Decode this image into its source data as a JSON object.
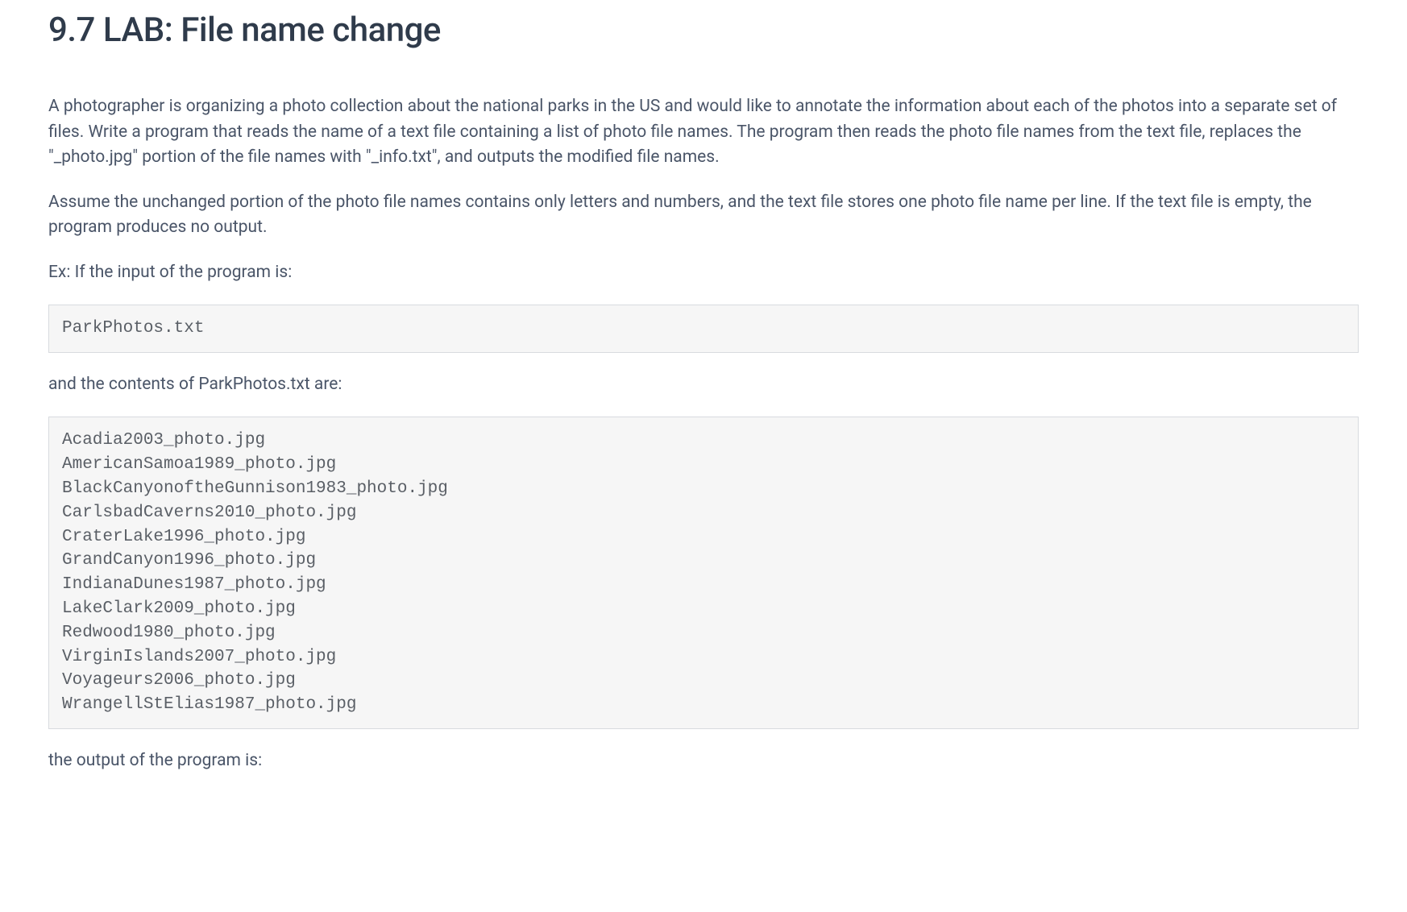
{
  "heading": "9.7 LAB: File name change",
  "para1": "A photographer is organizing a photo collection about the national parks in the US and would like to annotate the information about each of the photos into a separate set of files. Write a program that reads the name of a text file containing a list of photo file names. The program then reads the photo file names from the text file, replaces the \"_photo.jpg\" portion of the file names with \"_info.txt\", and outputs the modified file names.",
  "para2": "Assume the unchanged portion of the photo file names contains only letters and numbers, and the text file stores one photo file name per line. If the text file is empty, the program produces no output.",
  "para3": "Ex: If the input of the program is:",
  "code1": "ParkPhotos.txt",
  "para4": "and the contents of ParkPhotos.txt are:",
  "code2": "Acadia2003_photo.jpg\nAmericanSamoa1989_photo.jpg\nBlackCanyonoftheGunnison1983_photo.jpg\nCarlsbadCaverns2010_photo.jpg\nCraterLake1996_photo.jpg\nGrandCanyon1996_photo.jpg\nIndianaDunes1987_photo.jpg\nLakeClark2009_photo.jpg\nRedwood1980_photo.jpg\nVirginIslands2007_photo.jpg\nVoyageurs2006_photo.jpg\nWrangellStElias1987_photo.jpg",
  "para5": "the output of the program is:"
}
